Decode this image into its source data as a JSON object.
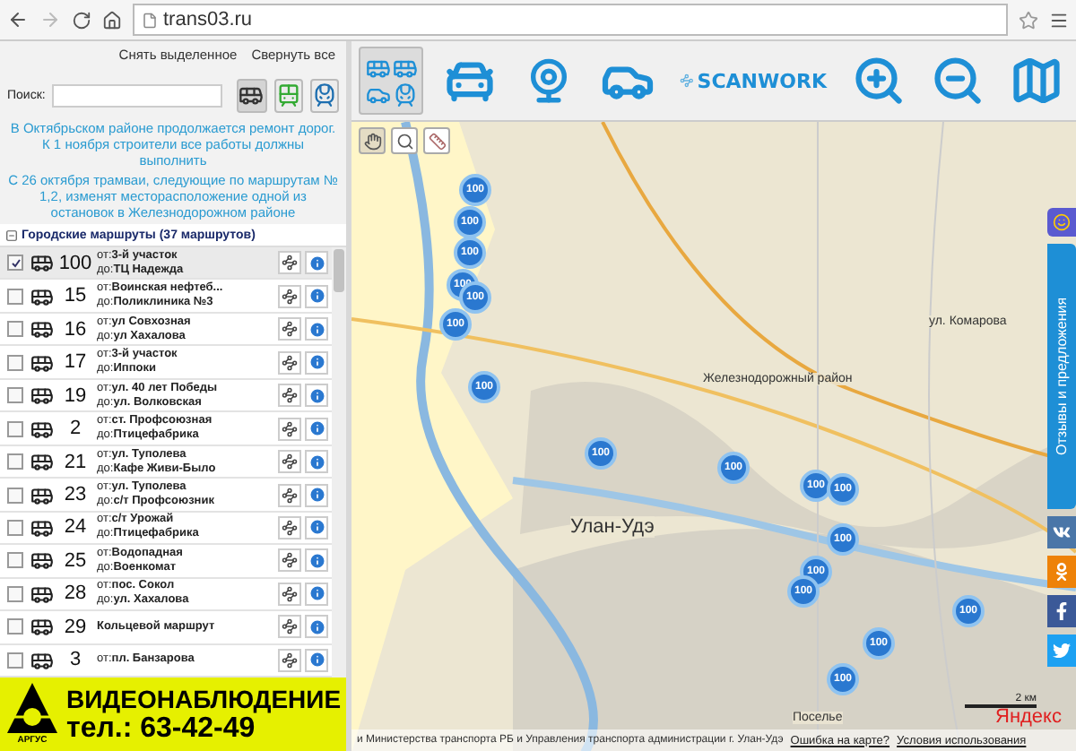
{
  "browser": {
    "address": "trans03.ru"
  },
  "panel": {
    "links": [
      {
        "label": "Снять выделенное"
      },
      {
        "label": "Свернуть все"
      }
    ],
    "search": {
      "label": "Поиск:"
    },
    "filters": [
      {
        "kind": "bus",
        "selected": true
      },
      {
        "kind": "trolley",
        "selected": false
      },
      {
        "kind": "tram",
        "selected": false
      }
    ],
    "news": [
      "В Октябрьском районе продолжается ремонт дорог. К 1 ноября строители все работы должны выполнить",
      "С 26 октября трамваи, следующие по маршрутам № 1,2, изменят месторасположение одной из остановок в Железнодорожном районе"
    ],
    "group": {
      "title": "Городские маршруты (37 маршрутов)",
      "expanded": true
    },
    "routes": [
      {
        "number": "100",
        "checked": true,
        "stops": [
          "от:**3-й участок**",
          "до:**ТЦ Надежда**"
        ]
      },
      {
        "number": "15",
        "checked": false,
        "stops": [
          "от:**Воинская нефтеб...**",
          "до:**Поликлиника №3**"
        ]
      },
      {
        "number": "16",
        "checked": false,
        "stops": [
          "от:**ул Совхозная**",
          "до:**ул Хахалова**"
        ]
      },
      {
        "number": "17",
        "checked": false,
        "stops": [
          "от:**3-й участок**",
          "до:**Иппоки**"
        ]
      },
      {
        "number": "19",
        "checked": false,
        "stops": [
          "от:**ул. 40 лет Победы**",
          "до:**ул. Волковская**"
        ]
      },
      {
        "number": "2",
        "checked": false,
        "stops": [
          "от:**ст. Профсоюзная**",
          "до:**Птицефабрика**"
        ]
      },
      {
        "number": "21",
        "checked": false,
        "stops": [
          "от:**ул. Туполева**",
          "до:**Кафе Живи-Было**"
        ]
      },
      {
        "number": "23",
        "checked": false,
        "stops": [
          "от:**ул. Туполева**",
          "до:**с/т Профсоюзник**"
        ]
      },
      {
        "number": "24",
        "checked": false,
        "stops": [
          "от:**с/т Урожай**",
          "до:**Птицефабрика**"
        ]
      },
      {
        "number": "25",
        "checked": false,
        "stops": [
          "от:**Водопадная**",
          "до:**Военкомат**"
        ]
      },
      {
        "number": "28",
        "checked": false,
        "stops": [
          "от:**пос. Сокол**",
          "до:**ул. Хахалова**"
        ]
      },
      {
        "number": "29",
        "checked": false,
        "stops": [
          "**Кольцевой маршрут**"
        ]
      },
      {
        "number": "3",
        "checked": false,
        "stops": [
          "от:**пл. Банзарова**"
        ]
      }
    ],
    "banner": {
      "title": "ВИДЕОНАБЛЮДЕНИЕ",
      "phone": "тел.: 63-42-49",
      "logo": "АРГУС"
    }
  },
  "toolbar": [
    {
      "kind": "transport",
      "selected": true
    },
    {
      "kind": "traffic",
      "selected": false
    },
    {
      "kind": "webcam",
      "selected": false
    },
    {
      "kind": "taxi",
      "selected": false
    },
    {
      "kind": "scanwork",
      "label": "SCANWORK",
      "selected": false
    },
    {
      "kind": "zoom-in",
      "selected": false
    },
    {
      "kind": "zoom-out",
      "selected": false
    },
    {
      "kind": "map",
      "selected": false
    }
  ],
  "map": {
    "tools": [
      {
        "kind": "pan",
        "selected": true
      },
      {
        "kind": "zoom",
        "selected": false
      },
      {
        "kind": "ruler",
        "selected": false
      }
    ],
    "labels": [
      "Улан-Удэ",
      "Железнодорожный район",
      "Поселье",
      "ул. Комарова"
    ],
    "markers": [
      "100",
      "100",
      "100",
      "100",
      "100",
      "100",
      "100",
      "100",
      "100",
      "100",
      "100",
      "100",
      "100",
      "100",
      "100",
      "100",
      "100"
    ],
    "scale": "2 км",
    "logo": "Яндекс",
    "credit": "и Министерства транспорта РБ и Управления транспорта администрации г. Улан-Удэ",
    "links": [
      "Ошибка на карте?",
      "Условия использования"
    ]
  },
  "feedback": {
    "label": "Отзывы и предложения"
  }
}
